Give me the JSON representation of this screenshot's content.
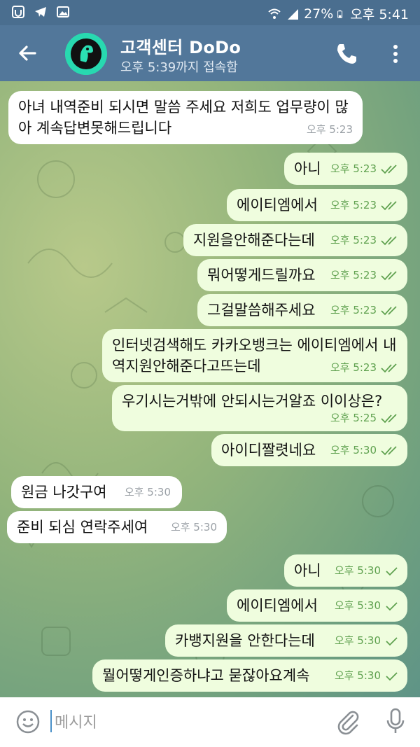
{
  "statusbar": {
    "battery": "27%",
    "time": "오후 5:41"
  },
  "header": {
    "title": "고객센터 DoDo",
    "subtitle": "오후 5:39까지 접속함"
  },
  "messages": [
    {
      "dir": "in",
      "text": "아녀 내역준비 되시면 말씀 주세요 저희도 업무량이 많아 계속답변못해드립니다",
      "time": "오후 5:23"
    },
    {
      "dir": "out",
      "text": "아니",
      "time": "오후 5:23",
      "read": true
    },
    {
      "dir": "out",
      "text": "에이티엠에서",
      "time": "오후 5:23",
      "read": true
    },
    {
      "dir": "out",
      "text": "지원을안해준다는데",
      "time": "오후 5:23",
      "read": true
    },
    {
      "dir": "out",
      "text": "뭐어떻게드릴까요",
      "time": "오후 5:23",
      "read": true
    },
    {
      "dir": "out",
      "text": "그걸말씀해주세요",
      "time": "오후 5:23",
      "read": true
    },
    {
      "dir": "out",
      "text": "인터넷검색해도 카카오뱅크는 에이티엠에서 내역지원안해준다고뜨는데",
      "time": "오후 5:23",
      "read": true
    },
    {
      "dir": "out",
      "text": "우기시는거밖에 안되시는거알죠 이이상은?",
      "time": "오후 5:25",
      "read": true
    },
    {
      "dir": "out",
      "text": "아이디짤렷네요",
      "time": "오후 5:30",
      "read": true
    },
    {
      "dir": "in",
      "text": "원금 나갓구여",
      "time": "오후 5:30"
    },
    {
      "dir": "in",
      "text": "준비 되심 연락주세여",
      "time": "오후 5:30"
    },
    {
      "dir": "out",
      "text": "아니",
      "time": "오후 5:30",
      "read": false
    },
    {
      "dir": "out",
      "text": "에이티엠에서",
      "time": "오후 5:30",
      "read": false
    },
    {
      "dir": "out",
      "text": "카뱅지원을 안한다는데",
      "time": "오후 5:30",
      "read": false
    },
    {
      "dir": "out",
      "text": "뭘어떻게인증하냐고 묻잖아요계속",
      "time": "오후 5:30",
      "read": false
    }
  ],
  "composer": {
    "placeholder": "메시지"
  },
  "colors": {
    "header": "#52779a",
    "statusbar": "#4a6e8f",
    "out_bubble": "#effdde",
    "in_bubble": "#ffffff",
    "tick": "#5fa14f"
  },
  "icons": [
    "back-arrow-icon",
    "phone-icon",
    "more-vertical-icon",
    "emoji-icon",
    "attach-icon",
    "mic-icon",
    "wifi-icon",
    "signal-icon",
    "battery-icon"
  ]
}
